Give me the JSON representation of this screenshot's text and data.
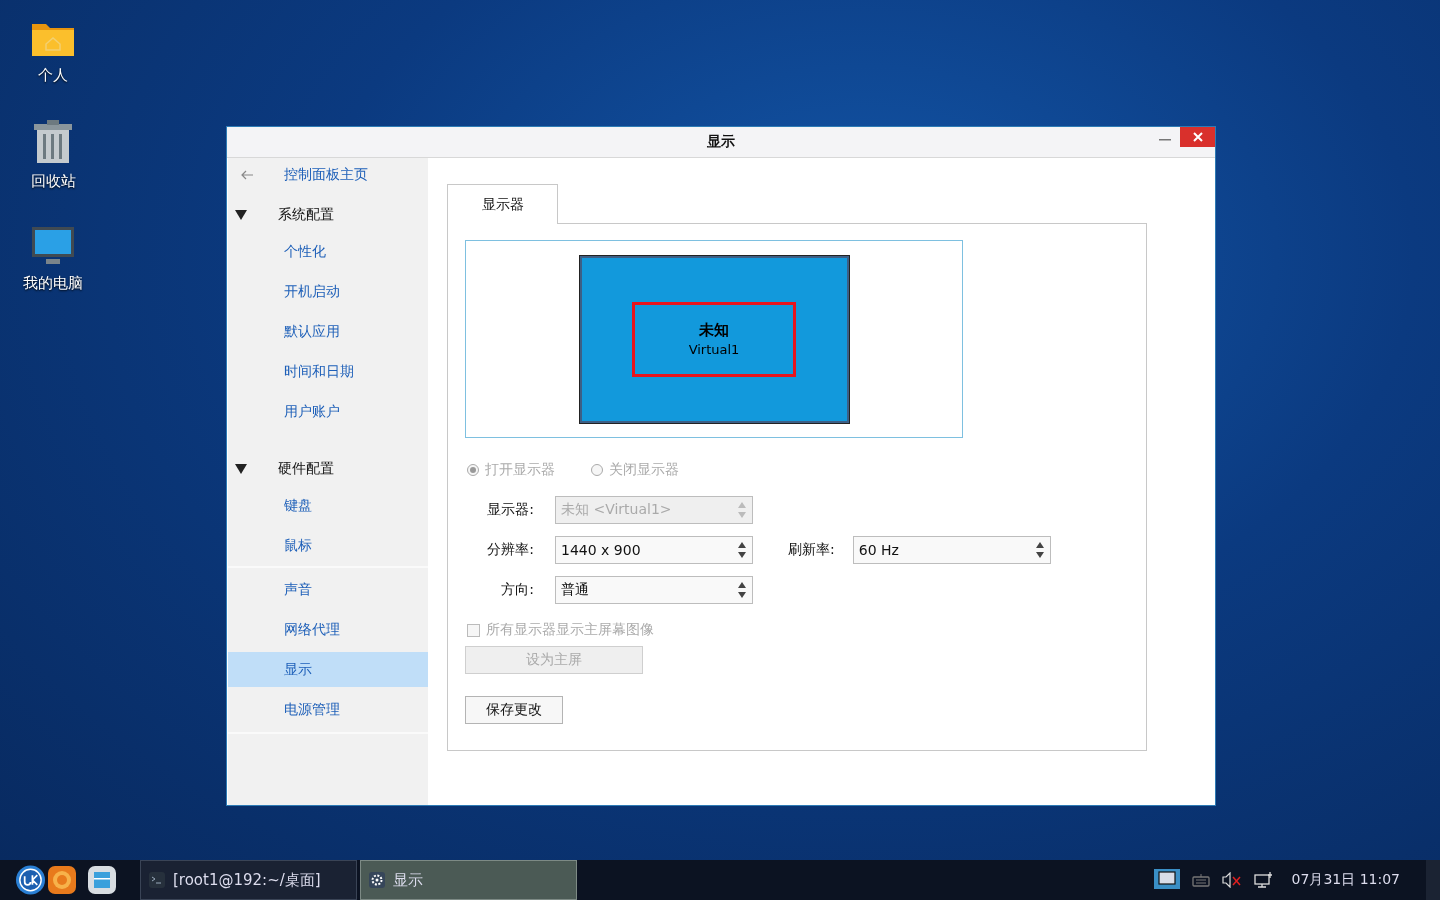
{
  "desktop": {
    "icons": [
      {
        "kind": "folder",
        "label": "个人"
      },
      {
        "kind": "trash",
        "label": "回收站"
      },
      {
        "kind": "computer",
        "label": "我的电脑"
      }
    ]
  },
  "window": {
    "title": "显示"
  },
  "sidebar": {
    "back": "控制面板主页",
    "items": [
      {
        "kind": "group",
        "label": "系统配置",
        "expanded": true,
        "children": [
          {
            "label": "个性化",
            "selected": false
          },
          {
            "label": "开机启动",
            "selected": false
          },
          {
            "label": "默认应用",
            "selected": false
          },
          {
            "label": "时间和日期",
            "selected": false
          },
          {
            "label": "用户账户",
            "selected": false
          }
        ]
      },
      {
        "kind": "group",
        "label": "硬件配置",
        "expanded": true,
        "children": [
          {
            "label": "键盘",
            "selected": false
          },
          {
            "label": "鼠标",
            "selected": false
          }
        ]
      },
      {
        "kind": "section",
        "children": [
          {
            "label": "声音",
            "selected": false
          },
          {
            "label": "网络代理",
            "selected": false
          },
          {
            "label": "显示",
            "selected": true
          },
          {
            "label": "电源管理",
            "selected": false
          }
        ]
      }
    ]
  },
  "tabs": [
    {
      "label": "显示器",
      "selected": true
    }
  ],
  "preview": {
    "name": "未知",
    "output": "Virtual1"
  },
  "power": {
    "disabled": true,
    "options": [
      {
        "label": "打开显示器",
        "selected": true
      },
      {
        "label": "关闭显示器",
        "selected": false
      }
    ]
  },
  "form_rows": [
    [
      {
        "label": "显示器:",
        "value": "未知 <Virtual1>",
        "disabled": true
      }
    ],
    [
      {
        "label": "分辨率:",
        "value": "1440 x 900",
        "disabled": false
      },
      {
        "label": "刷新率:",
        "value": "60 Hz",
        "disabled": false
      }
    ],
    [
      {
        "label": "方向:",
        "value": "普通",
        "disabled": false
      }
    ]
  ],
  "mirror": {
    "label": "所有显示器显示主屏幕图像",
    "checked": false,
    "disabled": true
  },
  "buttons": [
    {
      "label": "设为主屏",
      "disabled": true
    },
    {
      "label": "保存更改",
      "disabled": false
    }
  ],
  "taskbar": {
    "launchers": [
      {
        "kind": "start"
      },
      {
        "kind": "browser"
      },
      {
        "kind": "files"
      }
    ],
    "tasks": [
      {
        "kind": "terminal",
        "label": "[root1@192:~/桌面]",
        "selected": false
      },
      {
        "kind": "settings",
        "label": "显示",
        "selected": true
      }
    ],
    "tray": [
      {
        "kind": "display"
      },
      {
        "kind": "keyboard"
      },
      {
        "kind": "muted"
      },
      {
        "kind": "network"
      }
    ],
    "clock": "07月31日 11:07"
  }
}
